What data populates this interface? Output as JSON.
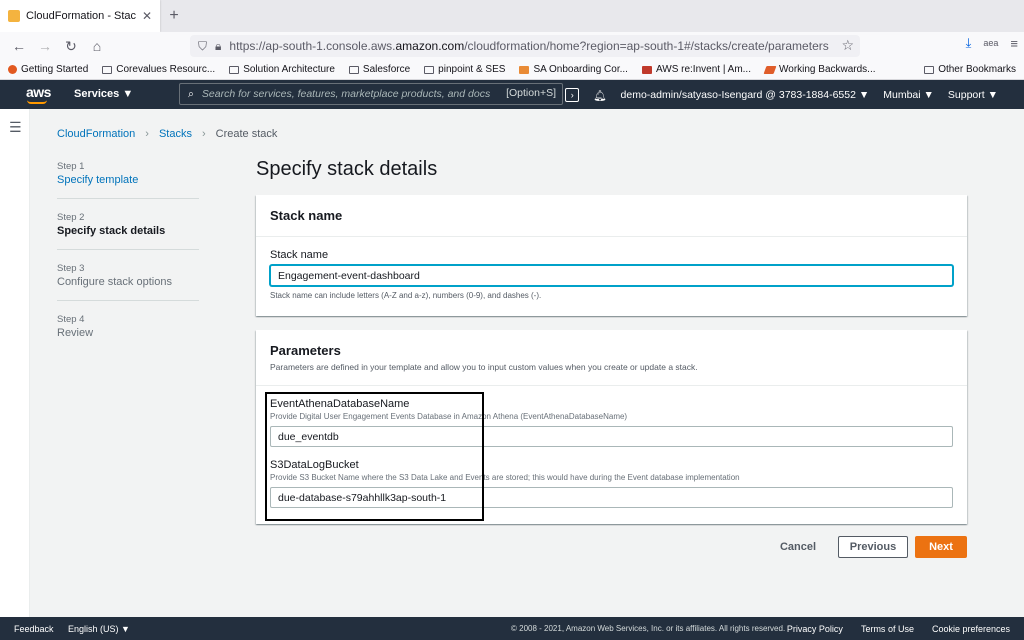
{
  "browser": {
    "tab_title": "CloudFormation - Stack",
    "url_prefix": "https://ap-south-1.console.aws.",
    "url_host": "amazon.com",
    "url_path": "/cloudformation/home?region=ap-south-1#/stacks/create/parameters",
    "bookmarks": [
      "Getting Started",
      "Corevalues Resourc...",
      "Solution Architecture",
      "Salesforce",
      "pinpoint & SES",
      "SA Onboarding Cor...",
      "AWS re:Invent | Am...",
      "Working Backwards..."
    ],
    "other_bookmarks": "Other Bookmarks"
  },
  "aws_header": {
    "logo": "aws",
    "services": "Services ▼",
    "search_placeholder": "Search for services, features, marketplace products, and docs",
    "search_hint": "[Option+S]",
    "account": "demo-admin/satyaso-Isengard @ 3783-1884-6552 ▼",
    "region": "Mumbai ▼",
    "support": "Support ▼"
  },
  "breadcrumb": {
    "root": "CloudFormation",
    "stacks": "Stacks",
    "current": "Create stack"
  },
  "steps": [
    {
      "num": "Step 1",
      "name": "Specify template"
    },
    {
      "num": "Step 2",
      "name": "Specify stack details"
    },
    {
      "num": "Step 3",
      "name": "Configure stack options"
    },
    {
      "num": "Step 4",
      "name": "Review"
    }
  ],
  "page_title": "Specify stack details",
  "stack_name_panel": {
    "title": "Stack name",
    "label": "Stack name",
    "value": "Engagement-event-dashboard",
    "hint": "Stack name can include letters (A-Z and a-z), numbers (0-9), and dashes (-)."
  },
  "parameters_panel": {
    "title": "Parameters",
    "description": "Parameters are defined in your template and allow you to input custom values when you create or update a stack.",
    "params": [
      {
        "name": "EventAthenaDatabaseName",
        "description": "Provide Digital User Engagement Events Database in Amazon Athena (EventAthenaDatabaseName)",
        "value": "due_eventdb"
      },
      {
        "name": "S3DataLogBucket",
        "description": "Provide S3 Bucket Name where the S3 Data Lake and Events are stored; this would have during the Event database implementation",
        "value": "due-database-s79ahhllk3ap-south-1"
      }
    ]
  },
  "actions": {
    "cancel": "Cancel",
    "previous": "Previous",
    "next": "Next"
  },
  "footer": {
    "feedback": "Feedback",
    "language": "English (US) ▼",
    "copyright": "© 2008 - 2021, Amazon Web Services, Inc. or its affiliates. All rights reserved.",
    "privacy": "Privacy Policy",
    "terms": "Terms of Use",
    "cookies": "Cookie preferences"
  },
  "colors": {
    "header_bg": "#232f3e",
    "link": "#0073bb",
    "primary_button": "#ec7211",
    "focus": "#00a1c9"
  }
}
